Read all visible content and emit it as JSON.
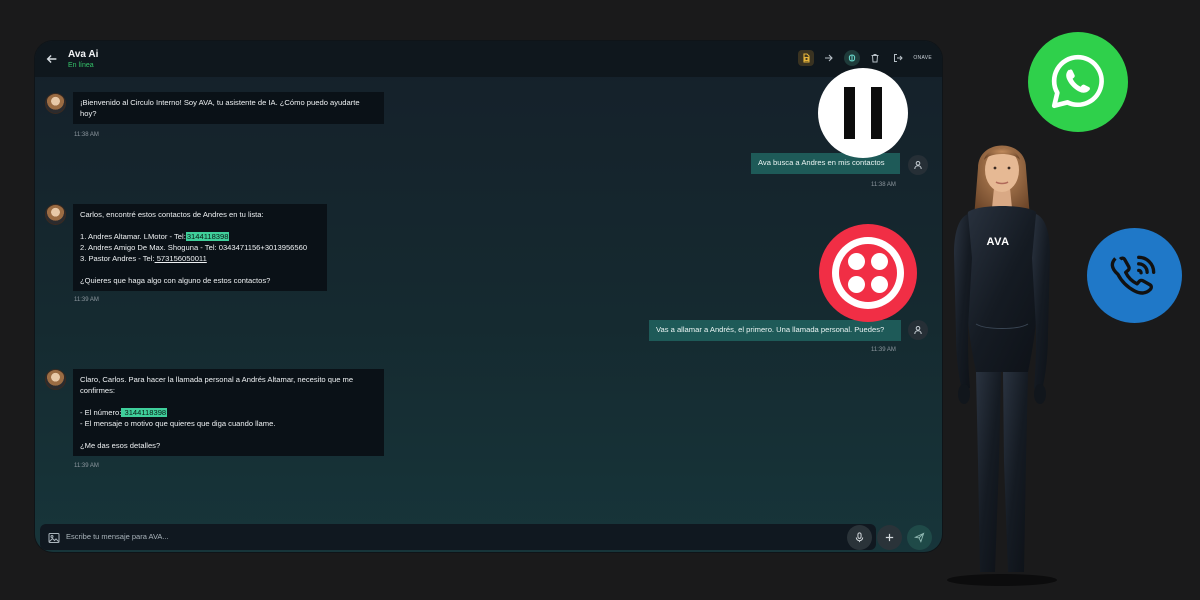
{
  "header": {
    "title": "Ava Ai",
    "status": "En línea",
    "right_text": "ONAVE"
  },
  "messages": [
    {
      "sender": "ava",
      "lines": [
        {
          "text": "¡Bienvenido al Circulo Interno! Soy AVA, tu asistente de IA. ¿Cómo puedo ayudarte"
        },
        {
          "text": "hoy?"
        }
      ],
      "time": "11:38 AM"
    },
    {
      "sender": "user",
      "text": "Ava busca a Andres en mis contactos",
      "time": "11:38 AM"
    },
    {
      "sender": "ava",
      "lines": [
        {
          "text": "Carlos, encontré estos contactos de Andres en tu lista:"
        },
        {
          "text": ""
        },
        {
          "prefix": "1. Andres Altamar. LMotor - Tel:",
          "phone": "3144118398",
          "style": "highlight"
        },
        {
          "text": "2. Andres Amigo De Max. Shoguna - Tel: 0343471156+3013956560"
        },
        {
          "prefix": "3. Pastor Andres - Tel:",
          "phone": " 573156050011",
          "style": "underline"
        },
        {
          "text": ""
        },
        {
          "text": "¿Quieres que haga algo con alguno de estos contactos?"
        }
      ],
      "time": "11:39 AM"
    },
    {
      "sender": "user",
      "text": "Vas a allamar a Andrés, el primero. Una llamada personal. Puedes?",
      "time": "11:39 AM"
    },
    {
      "sender": "ava",
      "lines": [
        {
          "text": "Claro, Carlos. Para hacer la llamada personal a Andrés Altamar, necesito que me"
        },
        {
          "text": "confirmes:"
        },
        {
          "text": ""
        },
        {
          "prefix": "- El número:",
          "phone": " 3144118398",
          "style": "highlight"
        },
        {
          "text": "- El mensaje o motivo que quieres que diga cuando llame."
        },
        {
          "text": ""
        },
        {
          "text": "¿Me das esos detalles?"
        }
      ],
      "time": "11:39 AM"
    }
  ],
  "input": {
    "placeholder": "Escribe tu mensaje para AVA..."
  },
  "figure": {
    "brand": "AVA"
  },
  "icons": {
    "header": [
      "back-arrow-icon",
      "sim-card-icon",
      "arrow-right-icon",
      "brain-icon",
      "trash-icon",
      "logout-icon"
    ],
    "input": [
      "image-icon",
      "emoji-icon",
      "microphone-icon",
      "plus-icon",
      "send-icon"
    ],
    "overlays": [
      "pause-icon",
      "twilio-logo",
      "whatsapp-logo",
      "phone-call-icon"
    ]
  },
  "colors": {
    "accent_green": "#35c46a",
    "user_bubble": "#1e5a58",
    "highlight": "#3fcf9b",
    "whatsapp": "#2fd04b",
    "twilio": "#f12e45",
    "phone": "#1f78c8"
  }
}
